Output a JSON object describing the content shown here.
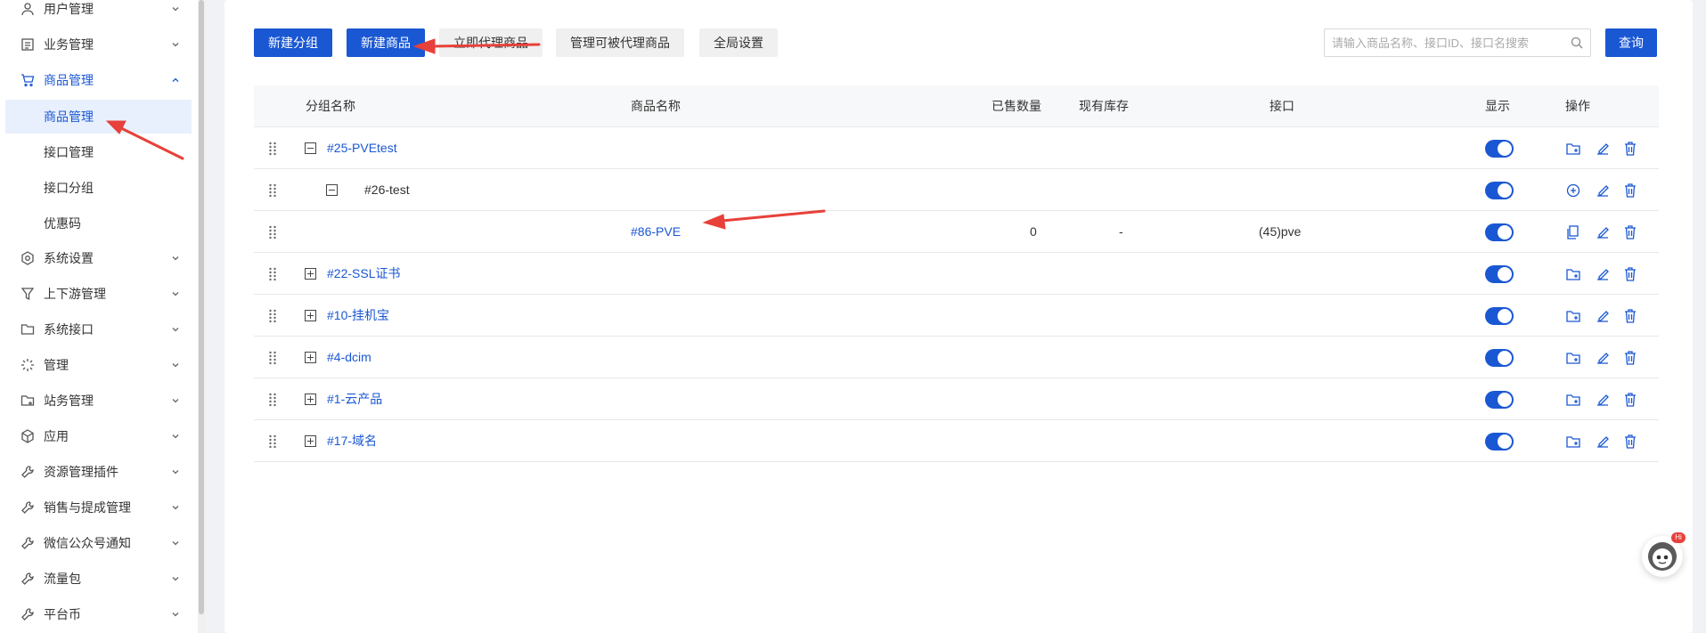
{
  "sidebar": {
    "items": [
      {
        "label": "用户管理",
        "icon": "user-icon"
      },
      {
        "label": "业务管理",
        "icon": "document-icon"
      },
      {
        "label": "商品管理",
        "icon": "cart-icon"
      },
      {
        "label": "系统设置",
        "icon": "gear-icon"
      },
      {
        "label": "上下游管理",
        "icon": "filter-icon"
      },
      {
        "label": "系统接口",
        "icon": "folder-icon"
      },
      {
        "label": "管理",
        "icon": "loading-icon"
      },
      {
        "label": "站务管理",
        "icon": "folder-add-icon"
      },
      {
        "label": "应用",
        "icon": "cube-icon"
      },
      {
        "label": "资源管理插件",
        "icon": "wrench-icon"
      },
      {
        "label": "销售与提成管理",
        "icon": "wrench-icon"
      },
      {
        "label": "微信公众号通知",
        "icon": "wrench-icon"
      },
      {
        "label": "流量包",
        "icon": "wrench-icon"
      },
      {
        "label": "平台币",
        "icon": "wrench-icon"
      }
    ],
    "submenu": [
      "商品管理",
      "接口管理",
      "接口分组",
      "优惠码"
    ]
  },
  "toolbar": {
    "new_group": "新建分组",
    "new_product": "新建商品",
    "proxy_product": "立即代理商品",
    "manage_proxy": "管理可被代理商品",
    "global_settings": "全局设置",
    "search_placeholder": "请输入商品名称、接口ID、接口名搜索",
    "query": "查询"
  },
  "table": {
    "headers": {
      "group": "分组名称",
      "product": "商品名称",
      "sold": "已售数量",
      "stock": "现有库存",
      "api": "接口",
      "display": "显示",
      "actions": "操作"
    },
    "rows": [
      {
        "group": "#25-PVEtest",
        "level": 0,
        "expanded": true,
        "product": "",
        "sold": "",
        "stock": "",
        "api": "",
        "display": true
      },
      {
        "group": "#26-test",
        "level": 1,
        "expanded": true,
        "product": "",
        "sold": "",
        "stock": "",
        "api": "",
        "display": true
      },
      {
        "group": "",
        "level": 2,
        "product": "#86-PVE",
        "sold": "0",
        "stock": "-",
        "api": "(45)pve",
        "display": true
      },
      {
        "group": "#22-SSL证书",
        "level": 0,
        "expanded": false,
        "product": "",
        "sold": "",
        "stock": "",
        "api": "",
        "display": true
      },
      {
        "group": "#10-挂机宝",
        "level": 0,
        "expanded": false,
        "product": "",
        "sold": "",
        "stock": "",
        "api": "",
        "display": true
      },
      {
        "group": "#4-dcim",
        "level": 0,
        "expanded": false,
        "product": "",
        "sold": "",
        "stock": "",
        "api": "",
        "display": true
      },
      {
        "group": "#1-云产品",
        "level": 0,
        "expanded": false,
        "product": "",
        "sold": "",
        "stock": "",
        "api": "",
        "display": true
      },
      {
        "group": "#17-域名",
        "level": 0,
        "expanded": false,
        "product": "",
        "sold": "",
        "stock": "",
        "api": "",
        "display": true
      }
    ]
  },
  "floating": {
    "badge": "Hi"
  },
  "colors": {
    "primary": "#1a57d3",
    "arrow": "#e8403a"
  }
}
